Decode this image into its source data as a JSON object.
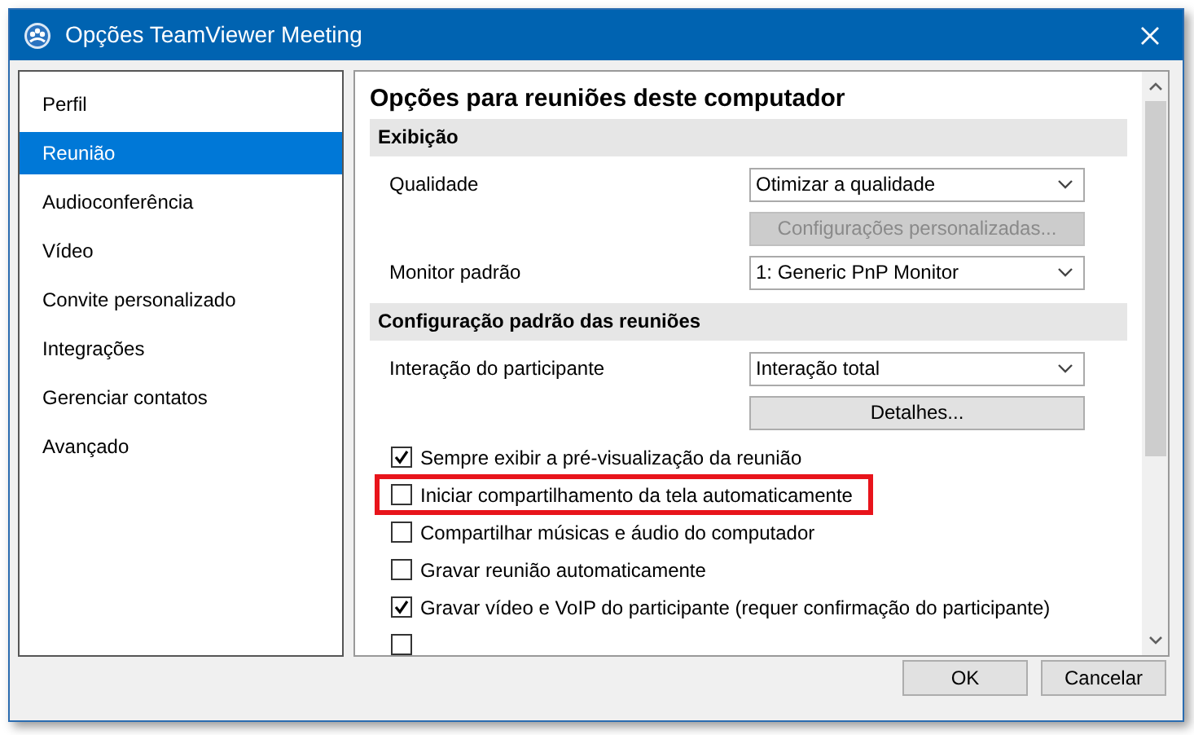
{
  "window": {
    "title": "Opções TeamViewer Meeting"
  },
  "sidebar": {
    "items": [
      {
        "label": "Perfil",
        "selected": false
      },
      {
        "label": "Reunião",
        "selected": true
      },
      {
        "label": "Audioconferência",
        "selected": false
      },
      {
        "label": "Vídeo",
        "selected": false
      },
      {
        "label": "Convite personalizado",
        "selected": false
      },
      {
        "label": "Integrações",
        "selected": false
      },
      {
        "label": "Gerenciar contatos",
        "selected": false
      },
      {
        "label": "Avançado",
        "selected": false
      }
    ]
  },
  "panel": {
    "heading": "Opções para reuniões deste computador",
    "sections": [
      {
        "title": "Exibição",
        "rows": [
          {
            "kind": "dropdown",
            "label": "Qualidade",
            "value": "Otimizar a qualidade"
          },
          {
            "kind": "button",
            "text": "Configurações personalizadas...",
            "disabled": true
          },
          {
            "kind": "dropdown",
            "label": "Monitor padrão",
            "value": "1: Generic PnP Monitor"
          }
        ]
      },
      {
        "title": "Configuração padrão das reuniões",
        "rows": [
          {
            "kind": "dropdown",
            "label": "Interação do participante",
            "value": "Interação total"
          },
          {
            "kind": "button",
            "text": "Detalhes...",
            "disabled": false
          }
        ]
      }
    ],
    "checkboxes": [
      {
        "label": "Sempre exibir a pré-visualização da reunião",
        "checked": true,
        "highlighted": false
      },
      {
        "label": "Iniciar compartilhamento da tela automaticamente",
        "checked": false,
        "highlighted": true
      },
      {
        "label": "Compartilhar músicas e áudio do computador",
        "checked": false,
        "highlighted": false
      },
      {
        "label": "Gravar reunião automaticamente",
        "checked": false,
        "highlighted": false
      },
      {
        "label": "Gravar vídeo e VoIP do participante (requer confirmação do participante)",
        "checked": true,
        "highlighted": false
      },
      {
        "checked": false,
        "highlighted": false
      }
    ]
  },
  "buttons": [
    "OK",
    "Cancelar"
  ]
}
